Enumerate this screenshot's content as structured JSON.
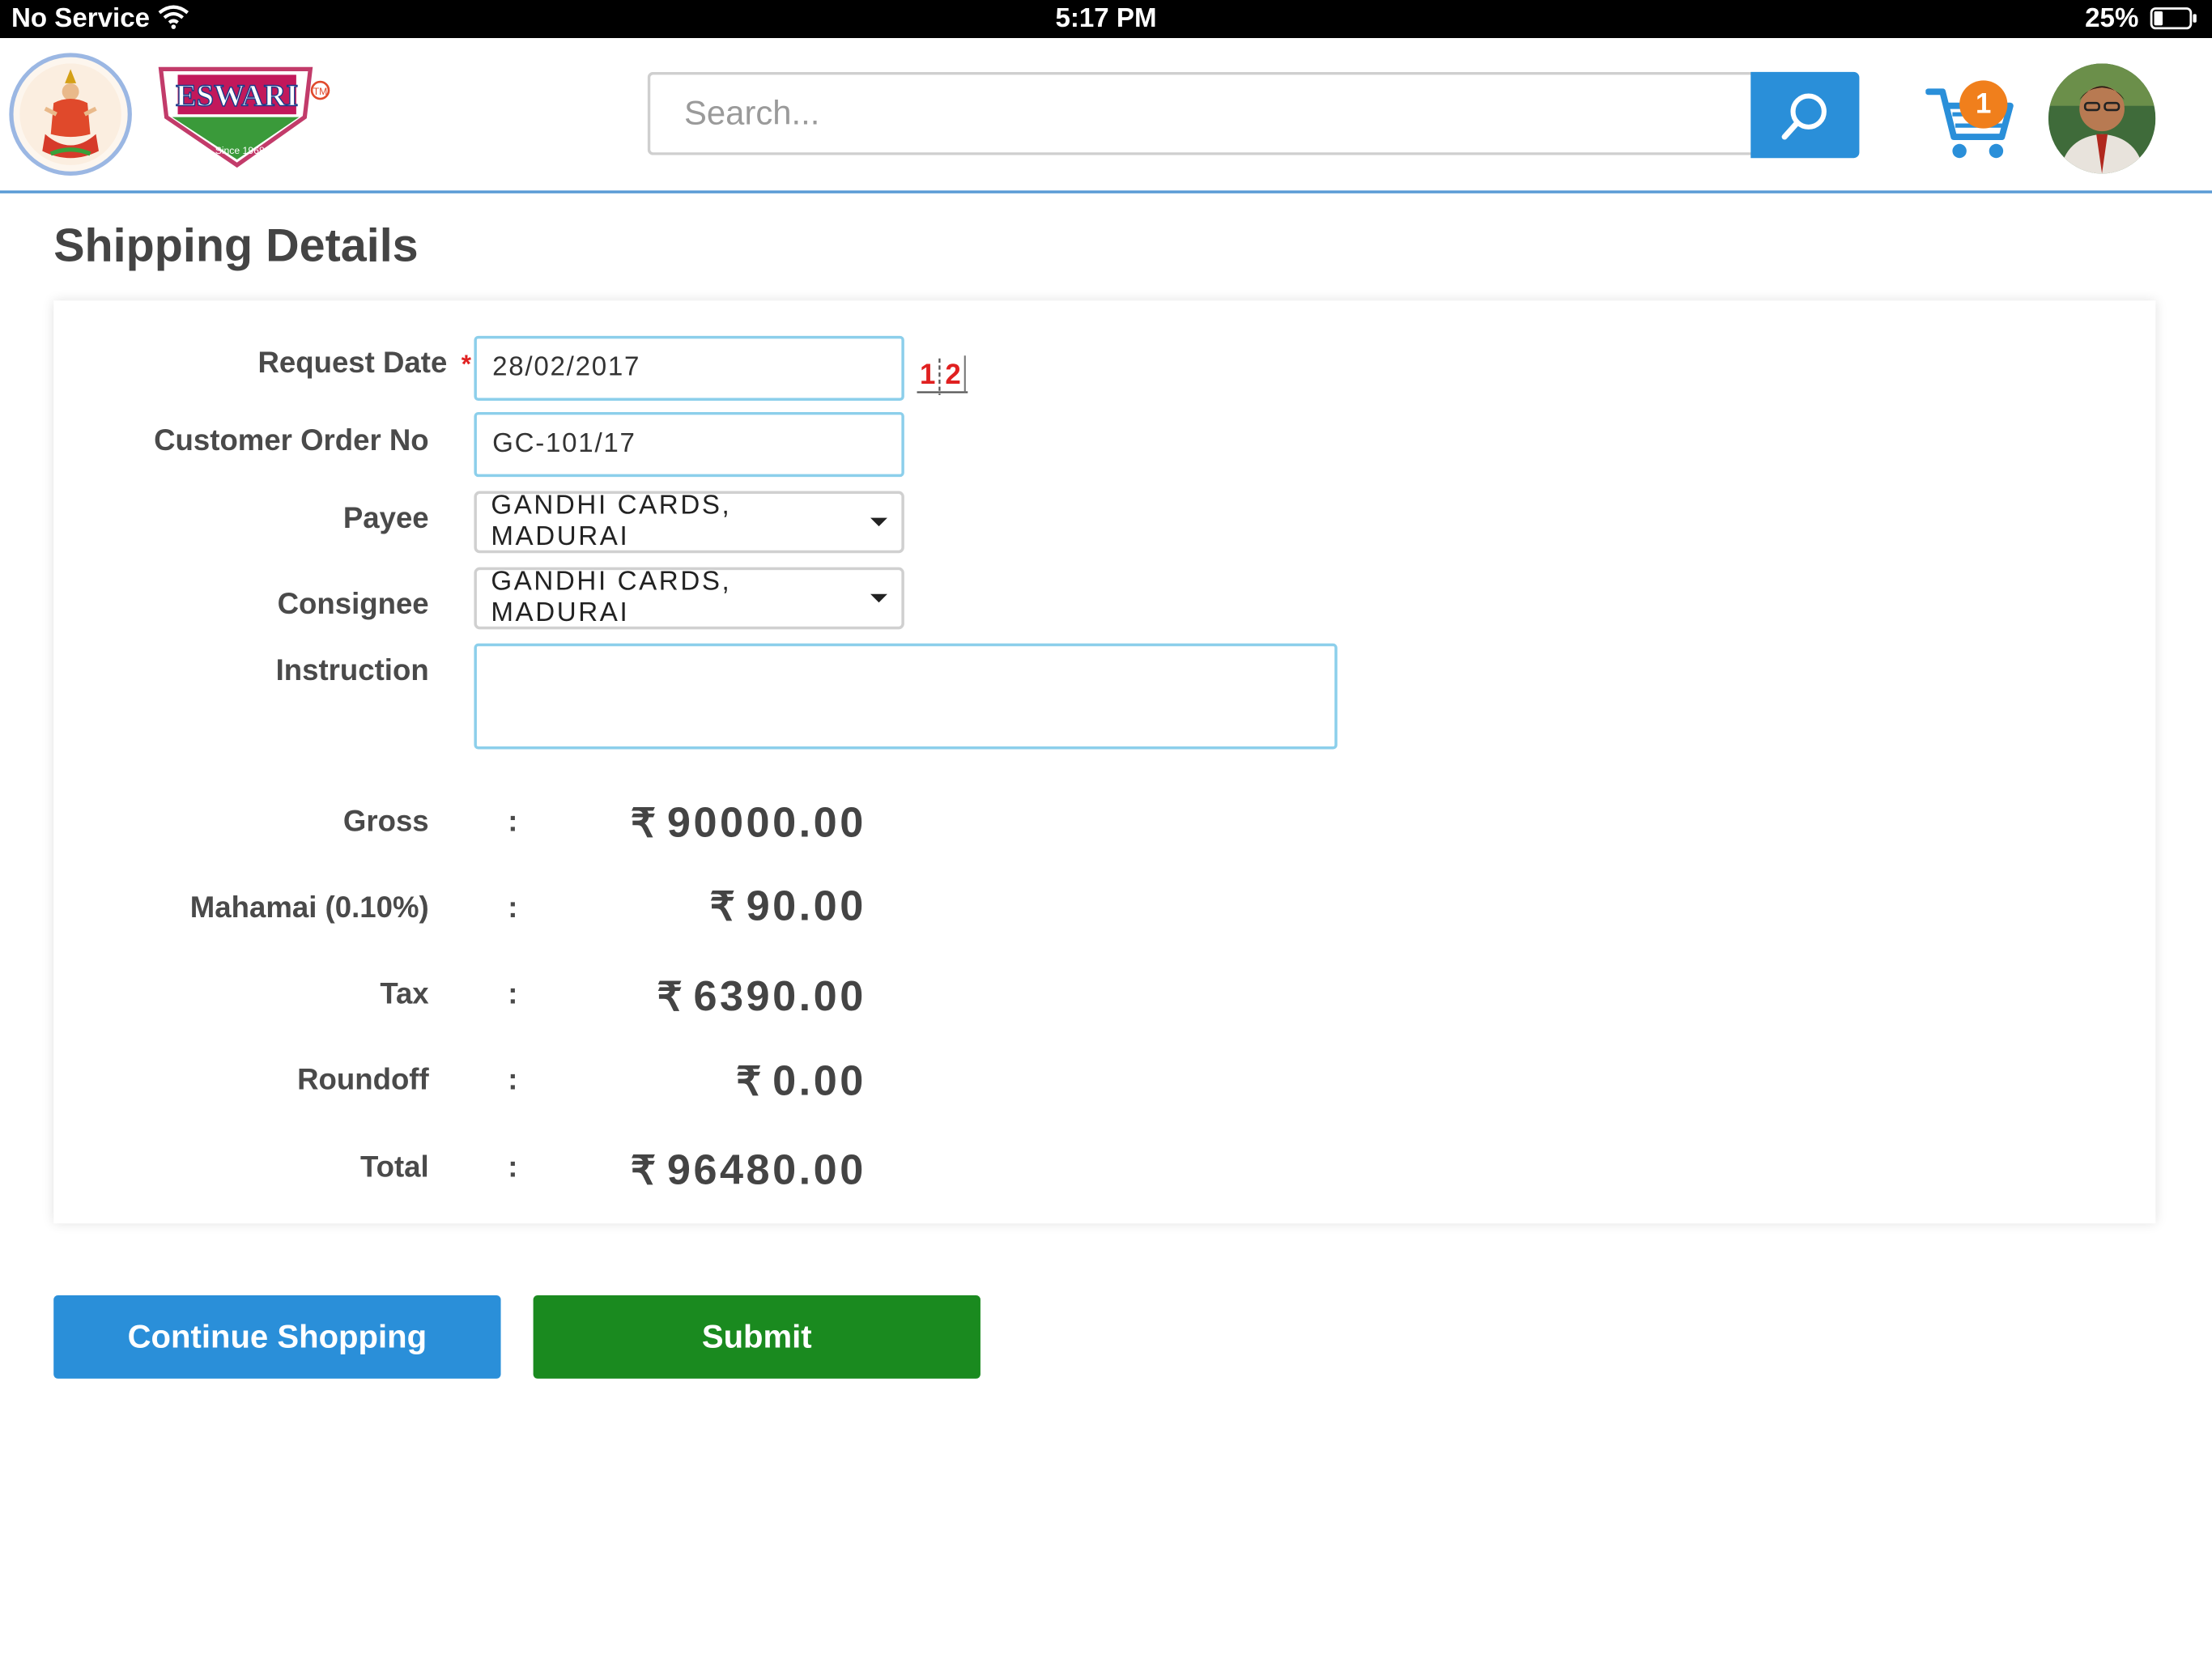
{
  "status_bar": {
    "carrier": "No Service",
    "time": "5:17 PM",
    "battery": "25%",
    "battery_level": 0.25
  },
  "header": {
    "brand_logo_text": "ESWARI",
    "brand_logo_since": "Since 1968",
    "search": {
      "placeholder": "Search...",
      "value": ""
    },
    "cart_count": "1",
    "accent_color": "#2a8fd9",
    "badge_color": "#f07f1c"
  },
  "page": {
    "title": "Shipping Details"
  },
  "form": {
    "request_date": {
      "label": "Request Date",
      "required_mark": "*",
      "value": "28/02/2017"
    },
    "calendar_icon_text": "1|2",
    "customer_order_no": {
      "label": "Customer Order No",
      "value": "GC-101/17"
    },
    "payee": {
      "label": "Payee",
      "value": "GANDHI CARDS, MADURAI"
    },
    "consignee": {
      "label": "Consignee",
      "value": "GANDHI CARDS, MADURAI"
    },
    "instruction": {
      "label": "Instruction",
      "value": ""
    },
    "colon": ":"
  },
  "summary": {
    "currency_symbol": "₹",
    "gross": {
      "label": "Gross",
      "value": "90000.00"
    },
    "mahamai": {
      "label": "Mahamai (0.10%)",
      "value": "90.00"
    },
    "tax": {
      "label": "Tax",
      "value": "6390.00"
    },
    "roundoff": {
      "label": "Roundoff",
      "value": "0.00"
    },
    "total": {
      "label": "Total",
      "value": "96480.00"
    }
  },
  "actions": {
    "continue_label": "Continue Shopping",
    "submit_label": "Submit",
    "continue_color": "#2a8fd9",
    "submit_color": "#1a8a1f"
  }
}
